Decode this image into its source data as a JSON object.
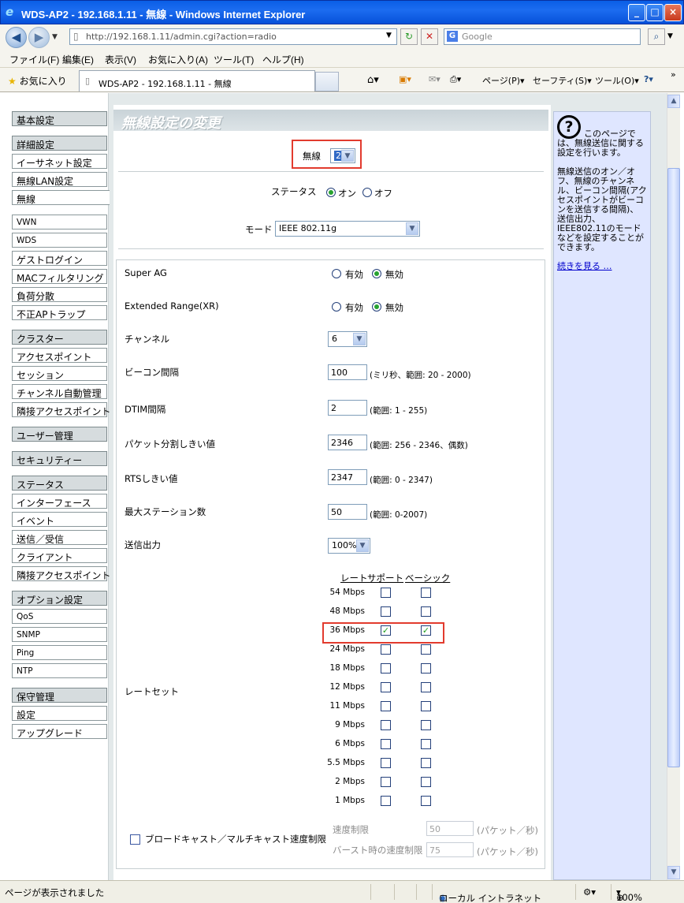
{
  "window": {
    "title": "WDS-AP2 - 192.168.1.11 - 無線 - Windows Internet Explorer",
    "min": "_",
    "max": "□",
    "close": "×"
  },
  "address": {
    "url": "http://192.168.1.11/admin.cgi?action=radio",
    "search_placeholder": "Google"
  },
  "menu": [
    "ファイル(F)",
    "編集(E)",
    "表示(V)",
    "お気に入り(A)",
    "ツール(T)",
    "ヘルプ(H)"
  ],
  "favbar": {
    "favorites": "お気に入り",
    "tab_title": "WDS-AP2 - 192.168.1.11 - 無線",
    "page": "ページ(P)",
    "safety": "セーフティ(S)",
    "tools": "ツール(O)"
  },
  "sidebar": {
    "items": [
      {
        "label": "基本設定",
        "type": "hd"
      },
      {
        "label": "詳細設定",
        "type": "hd"
      },
      {
        "label": "イーサネット設定",
        "type": "item"
      },
      {
        "label": "無線LAN設定",
        "type": "item"
      },
      {
        "label": "無線",
        "type": "sel"
      },
      {
        "label": "VWN",
        "type": "item"
      },
      {
        "label": "WDS",
        "type": "item"
      },
      {
        "label": "ゲストログイン",
        "type": "item"
      },
      {
        "label": "MACフィルタリング",
        "type": "item"
      },
      {
        "label": "負荷分散",
        "type": "item"
      },
      {
        "label": "不正APトラップ",
        "type": "item"
      },
      {
        "label": "クラスター",
        "type": "hd"
      },
      {
        "label": "アクセスポイント",
        "type": "item"
      },
      {
        "label": "セッション",
        "type": "item"
      },
      {
        "label": "チャンネル自動管理",
        "type": "item"
      },
      {
        "label": "隣接アクセスポイント",
        "type": "item"
      },
      {
        "label": "ユーザー管理",
        "type": "hd"
      },
      {
        "label": "セキュリティー",
        "type": "hd"
      },
      {
        "label": "ステータス",
        "type": "hd"
      },
      {
        "label": "インターフェース",
        "type": "item"
      },
      {
        "label": "イベント",
        "type": "item"
      },
      {
        "label": "送信／受信",
        "type": "item"
      },
      {
        "label": "クライアント",
        "type": "item"
      },
      {
        "label": "隣接アクセスポイント",
        "type": "item"
      },
      {
        "label": "オプション設定",
        "type": "hd"
      },
      {
        "label": "QoS",
        "type": "item"
      },
      {
        "label": "SNMP",
        "type": "item"
      },
      {
        "label": "Ping",
        "type": "item"
      },
      {
        "label": "NTP",
        "type": "item"
      },
      {
        "label": "保守管理",
        "type": "hd"
      },
      {
        "label": "設定",
        "type": "item"
      },
      {
        "label": "アップグレード",
        "type": "item"
      }
    ]
  },
  "main": {
    "title": "無線設定の変更",
    "radio_label": "無線",
    "radio_value": "2",
    "status_label": "ステータス",
    "status_on": "オン",
    "status_off": "オフ",
    "mode_label": "モード",
    "mode_value": "IEEE 802.11g",
    "super_ag_label": "Super AG",
    "xr_label": "Extended Range(XR)",
    "enabled": "有効",
    "disabled": "無効",
    "channel_label": "チャンネル",
    "channel_value": "6",
    "beacon_label": "ビーコン間隔",
    "beacon_value": "100",
    "beacon_hint": "(ミリ秒、範囲: 20 - 2000)",
    "dtim_label": "DTIM間隔",
    "dtim_value": "2",
    "dtim_hint": "(範囲: 1 - 255)",
    "frag_label": "パケット分割しきい値",
    "frag_value": "2346",
    "frag_hint": "(範囲: 256 - 2346、偶数)",
    "rts_label": "RTSしきい値",
    "rts_value": "2347",
    "rts_hint": "(範囲: 0 - 2347)",
    "maxsta_label": "最大ステーション数",
    "maxsta_value": "50",
    "maxsta_hint": "(範囲: 0-2007)",
    "txpower_label": "送信出力",
    "txpower_value": "100%",
    "rateset_label": "レートセット",
    "rate_headers": {
      "rate": "レート",
      "support": "サポート",
      "basic": "ベーシック"
    },
    "rates": [
      {
        "rate": "54 Mbps",
        "support": false,
        "basic": false
      },
      {
        "rate": "48 Mbps",
        "support": false,
        "basic": false
      },
      {
        "rate": "36 Mbps",
        "support": true,
        "basic": true
      },
      {
        "rate": "24 Mbps",
        "support": false,
        "basic": false
      },
      {
        "rate": "18 Mbps",
        "support": false,
        "basic": false
      },
      {
        "rate": "12 Mbps",
        "support": false,
        "basic": false
      },
      {
        "rate": "11 Mbps",
        "support": false,
        "basic": false
      },
      {
        "rate": "9 Mbps",
        "support": false,
        "basic": false
      },
      {
        "rate": "6 Mbps",
        "support": false,
        "basic": false
      },
      {
        "rate": "5.5 Mbps",
        "support": false,
        "basic": false
      },
      {
        "rate": "2 Mbps",
        "support": false,
        "basic": false
      },
      {
        "rate": "1 Mbps",
        "support": false,
        "basic": false
      }
    ],
    "bcast_label": "ブロードキャスト／マルチキャスト速度制限",
    "rate_limit_label": "速度制限",
    "rate_limit_value": "50",
    "rate_limit_unit": "(パケット／秒)",
    "burst_label": "バースト時の速度制限",
    "burst_value": "75",
    "burst_unit": "(パケット／秒)"
  },
  "help": {
    "icon": "?",
    "text1": "このページでは、無線送信に関する設定を行います。",
    "text2": "無線送信のオン／オフ、無線のチャンネル、ビーコン間隔(アクセスポイントがビーコンを送信する間隔)、送信出力、IEEE802.11のモードなどを設定することができます。",
    "more": "続きを見る …"
  },
  "status": {
    "left": "ページが表示されました",
    "zone": "ローカル イントラネット",
    "zoom": "100%"
  }
}
